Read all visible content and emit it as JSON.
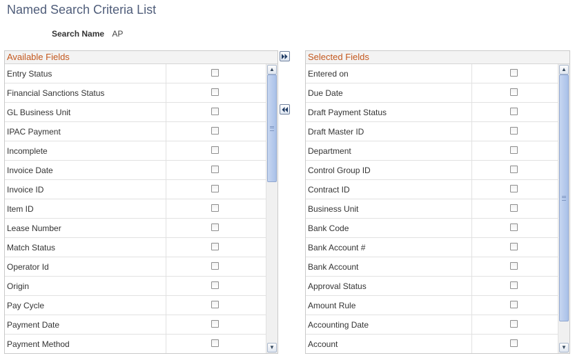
{
  "page": {
    "title": "Named Search Criteria List"
  },
  "search_name": {
    "label": "Search Name",
    "value": "AP"
  },
  "available": {
    "header": "Available Fields",
    "items": [
      {
        "label": "Entry Status",
        "checked": false
      },
      {
        "label": "Financial Sanctions Status",
        "checked": false
      },
      {
        "label": "GL Business Unit",
        "checked": false
      },
      {
        "label": "IPAC Payment",
        "checked": false
      },
      {
        "label": "Incomplete",
        "checked": false
      },
      {
        "label": "Invoice Date",
        "checked": false
      },
      {
        "label": "Invoice ID",
        "checked": false
      },
      {
        "label": "Item ID",
        "checked": false
      },
      {
        "label": "Lease Number",
        "checked": false
      },
      {
        "label": "Match Status",
        "checked": false
      },
      {
        "label": "Operator Id",
        "checked": false
      },
      {
        "label": "Origin",
        "checked": false
      },
      {
        "label": "Pay Cycle",
        "checked": false
      },
      {
        "label": "Payment Date",
        "checked": false
      },
      {
        "label": "Payment Method",
        "checked": false
      }
    ],
    "scroll_position": 0.0,
    "scroll_thumb_fraction": 0.4
  },
  "selected": {
    "header": "Selected Fields",
    "items": [
      {
        "label": "Entered on",
        "checked": false
      },
      {
        "label": "Due Date",
        "checked": false
      },
      {
        "label": "Draft Payment Status",
        "checked": false
      },
      {
        "label": "Draft Master ID",
        "checked": false
      },
      {
        "label": "Department",
        "checked": false
      },
      {
        "label": "Control Group ID",
        "checked": false
      },
      {
        "label": "Contract ID",
        "checked": false
      },
      {
        "label": "Business Unit",
        "checked": false
      },
      {
        "label": "Bank Code",
        "checked": false
      },
      {
        "label": "Bank Account #",
        "checked": false
      },
      {
        "label": "Bank Account",
        "checked": false
      },
      {
        "label": "Approval Status",
        "checked": false
      },
      {
        "label": "Amount Rule",
        "checked": false
      },
      {
        "label": "Accounting Date",
        "checked": false
      },
      {
        "label": "Account",
        "checked": false
      }
    ],
    "scroll_position": 0.0,
    "scroll_thumb_fraction": 0.92
  },
  "icons": {
    "add": "double-chevron-right-icon",
    "remove": "double-chevron-left-icon"
  },
  "colors": {
    "title": "#4f5d7a",
    "panel_header": "#c4581e",
    "icon": "#1f3b63"
  }
}
